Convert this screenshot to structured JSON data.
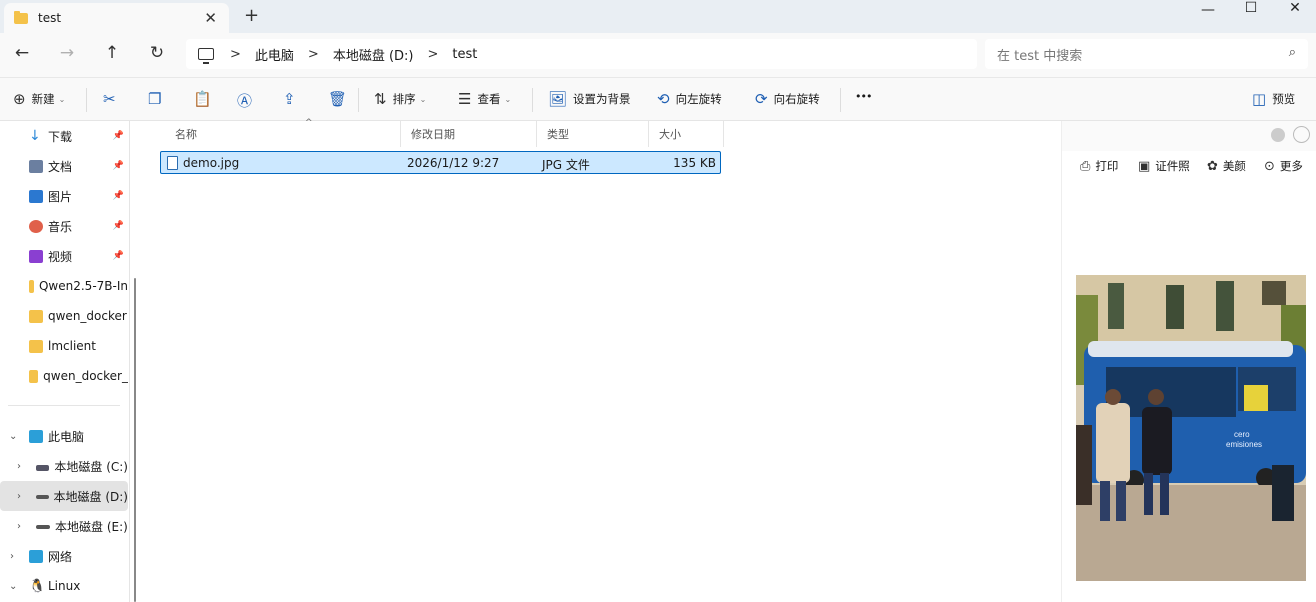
{
  "tab": {
    "title": "test",
    "close": "✕",
    "new_tab": "+"
  },
  "window_controls": {
    "minimize": "—",
    "maximize": "☐",
    "close": "✕"
  },
  "nav_buttons": {
    "back": "←",
    "forward": "→",
    "up": "↑",
    "refresh": "↻"
  },
  "breadcrumb": {
    "items": [
      "此电脑",
      "本地磁盘 (D:)",
      "test"
    ],
    "sep": ">"
  },
  "search": {
    "placeholder": "在 test 中搜索"
  },
  "toolbar": {
    "new": "新建",
    "sort": "排序",
    "view": "查看",
    "set_bg": "设置为背景",
    "rotate_left": "向左旋转",
    "rotate_right": "向右旋转",
    "more": "•••",
    "preview": "预览"
  },
  "sidebar": {
    "quick": [
      {
        "label": "下载",
        "color": "#2b88d8"
      },
      {
        "label": "文档",
        "color": "#6b7fa0"
      },
      {
        "label": "图片",
        "color": "#2b78d0"
      },
      {
        "label": "音乐",
        "color": "#e0604a"
      },
      {
        "label": "视频",
        "color": "#8a3fd1"
      }
    ],
    "folders": [
      "Qwen2.5-7B-In",
      "qwen_docker",
      "lmclient",
      "qwen_docker_"
    ],
    "tree": [
      "此电脑",
      "本地磁盘 (C:)",
      "本地磁盘 (D:)",
      "本地磁盘 (E:)",
      "网络",
      "Linux"
    ]
  },
  "columns": {
    "name": "名称",
    "date": "修改日期",
    "type": "类型",
    "size": "大小"
  },
  "files": [
    {
      "name": "demo.jpg",
      "date": "2026/1/12 9:27",
      "type": "JPG 文件",
      "size": "135 KB"
    }
  ],
  "preview_actions": {
    "print": "打印",
    "id_photo": "证件照",
    "beautify": "美颜",
    "more": "更多"
  },
  "photo_text": {
    "line1": "cero",
    "line2": "emisiones"
  }
}
